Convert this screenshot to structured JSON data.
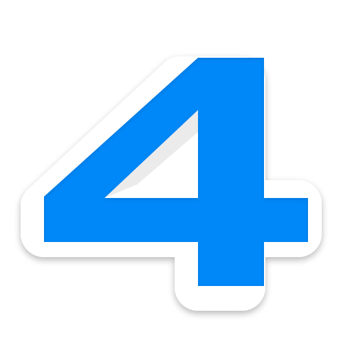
{
  "app_icon": {
    "glyph": "4",
    "icon_name": "number-four-icon",
    "colors": {
      "background": "#ffffff",
      "glyph_fill": "#0088f8",
      "sticker_outline": "#ffffff",
      "shadow": "#000000"
    }
  }
}
